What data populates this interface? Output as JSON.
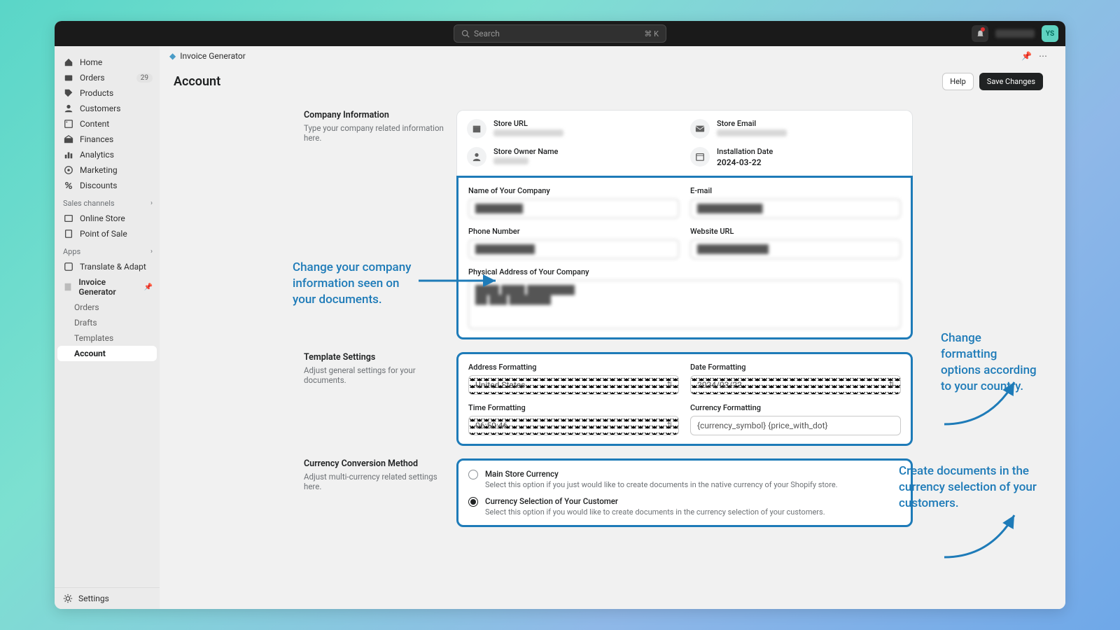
{
  "topbar": {
    "search_placeholder": "Search",
    "shortcut": "⌘ K",
    "avatar": "YS"
  },
  "sidebar": {
    "items": [
      {
        "label": "Home"
      },
      {
        "label": "Orders",
        "badge": "29"
      },
      {
        "label": "Products"
      },
      {
        "label": "Customers"
      },
      {
        "label": "Content"
      },
      {
        "label": "Finances"
      },
      {
        "label": "Analytics"
      },
      {
        "label": "Marketing"
      },
      {
        "label": "Discounts"
      }
    ],
    "sales_channels_label": "Sales channels",
    "channels": [
      {
        "label": "Online Store"
      },
      {
        "label": "Point of Sale"
      }
    ],
    "apps_label": "Apps",
    "apps": [
      {
        "label": "Translate & Adapt"
      },
      {
        "label": "Invoice Generator",
        "children": [
          "Orders",
          "Drafts",
          "Templates",
          "Account"
        ]
      }
    ],
    "settings_label": "Settings"
  },
  "breadcrumb": {
    "app_name": "Invoice Generator"
  },
  "page": {
    "title": "Account",
    "help": "Help",
    "save": "Save Changes"
  },
  "company": {
    "heading": "Company Information",
    "subtext": "Type your company related information here.",
    "store_url_label": "Store URL",
    "store_email_label": "Store Email",
    "owner_label": "Store Owner Name",
    "install_label": "Installation Date",
    "install_value": "2024-03-22",
    "fields": {
      "name": "Name of Your Company",
      "email": "E-mail",
      "phone": "Phone Number",
      "website": "Website URL",
      "address": "Physical Address of Your Company"
    }
  },
  "template": {
    "heading": "Template Settings",
    "subtext": "Adjust general settings for your documents.",
    "address_label": "Address Formatting",
    "address_value": "United States",
    "date_label": "Date Formatting",
    "date_value": "2024/03/22",
    "time_label": "Time Formatting",
    "time_value": "06:50:46",
    "currency_label": "Currency Formatting",
    "currency_value": "{currency_symbol} {price_with_dot}"
  },
  "currency": {
    "heading": "Currency Conversion Method",
    "subtext": "Adjust multi-currency related settings here.",
    "opt1_label": "Main Store Currency",
    "opt1_desc": "Select this option if you just would like to create documents in the native currency of your Shopify store.",
    "opt2_label": "Currency Selection of Your Customer",
    "opt2_desc": "Select this option if you would like to create documents in the currency selection of your customers."
  },
  "callouts": {
    "c1": "Change your company information seen on your documents.",
    "c2": "Change formatting options according to your country.",
    "c3": "Create documents in the currency selection of your customers."
  }
}
